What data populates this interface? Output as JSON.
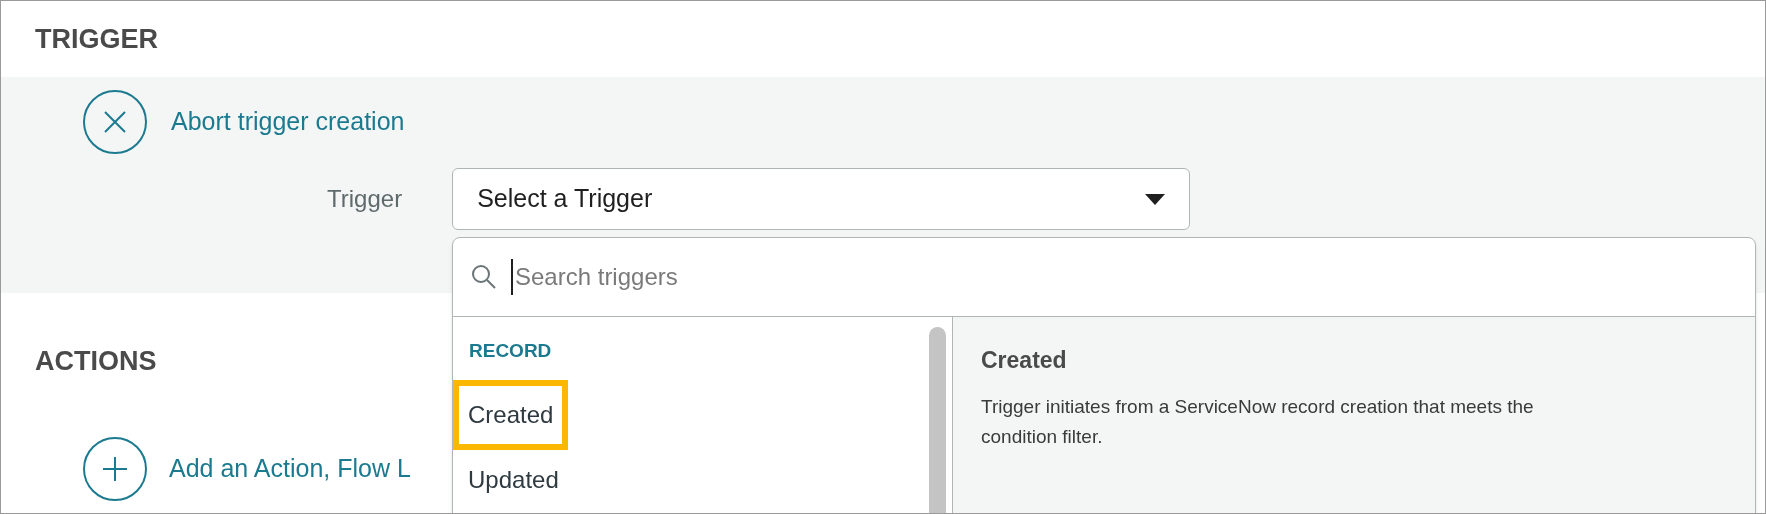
{
  "trigger_section": {
    "heading": "TRIGGER",
    "abort_link": "Abort trigger creation",
    "field_label": "Trigger",
    "select_value": "Select a Trigger"
  },
  "actions_section": {
    "heading": "ACTIONS",
    "add_link": "Add an Action, Flow L"
  },
  "trigger_popup": {
    "search": {
      "placeholder": "Search triggers"
    },
    "group": "RECORD",
    "items": [
      {
        "label": "Created",
        "selected": true
      },
      {
        "label": "Updated",
        "selected": false
      }
    ],
    "detail": {
      "title": "Created",
      "description": "Trigger initiates from a ServiceNow record creation that meets the condition filter."
    }
  }
}
